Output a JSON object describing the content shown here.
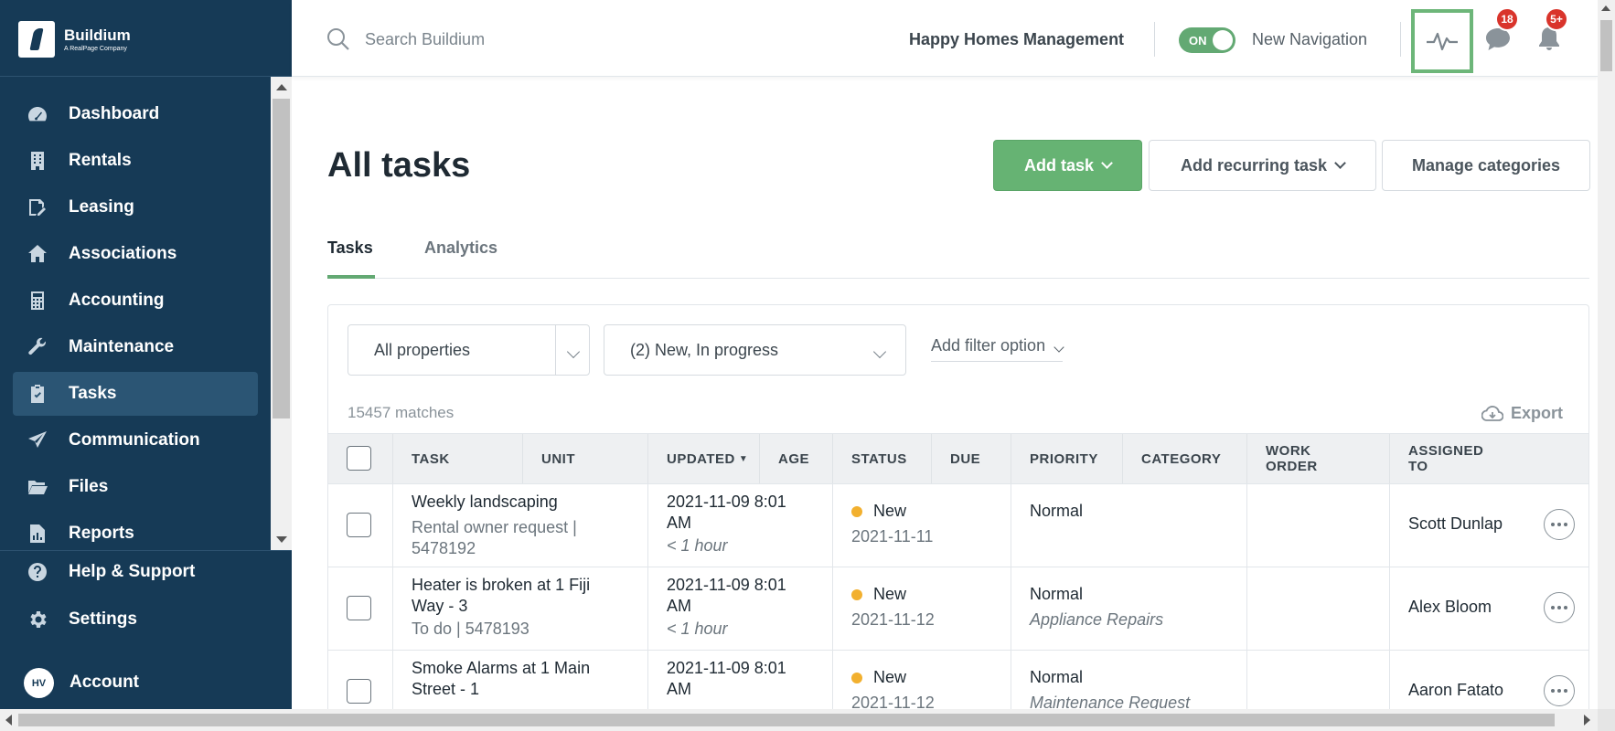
{
  "brand": {
    "name": "Buildium",
    "tagline": "A RealPage Company"
  },
  "sidebar": {
    "items": [
      {
        "label": "Dashboard",
        "icon": "dashboard-icon",
        "active": false
      },
      {
        "label": "Rentals",
        "icon": "building-icon",
        "active": false
      },
      {
        "label": "Leasing",
        "icon": "leasing-icon",
        "active": false
      },
      {
        "label": "Associations",
        "icon": "associations-icon",
        "active": false
      },
      {
        "label": "Accounting",
        "icon": "calculator-icon",
        "active": false
      },
      {
        "label": "Maintenance",
        "icon": "wrench-icon",
        "active": false
      },
      {
        "label": "Tasks",
        "icon": "clipboard-icon",
        "active": true
      },
      {
        "label": "Communication",
        "icon": "paper-plane-icon",
        "active": false
      },
      {
        "label": "Files",
        "icon": "folder-icon",
        "active": false
      },
      {
        "label": "Reports",
        "icon": "reports-icon",
        "active": false
      }
    ],
    "bottom": [
      {
        "label": "Help & Support",
        "icon": "help-icon"
      },
      {
        "label": "Settings",
        "icon": "gear-icon"
      },
      {
        "label": "Account",
        "icon": "avatar"
      }
    ],
    "avatar_initials": "HV"
  },
  "header": {
    "search_placeholder": "Search Buildium",
    "company": "Happy Homes Management",
    "toggle_label": "ON",
    "new_nav_label": "New Navigation",
    "messages_badge": "18",
    "notifications_badge": "5+",
    "accent_color": "#6db679"
  },
  "page": {
    "title": "All tasks",
    "add_task": "Add task",
    "add_recurring": "Add recurring task",
    "manage_categories": "Manage categories",
    "tabs": [
      {
        "label": "Tasks",
        "active": true
      },
      {
        "label": "Analytics",
        "active": false
      }
    ]
  },
  "filters": {
    "property": "All properties",
    "status": "(2) New, In progress",
    "add_filter": "Add filter option",
    "matches": "15457 matches",
    "export": "Export"
  },
  "table": {
    "headers": {
      "task": "TASK",
      "unit": "UNIT",
      "updated": "UPDATED",
      "age": "AGE",
      "status": "STATUS",
      "due": "DUE",
      "priority": "PRIORITY",
      "category": "CATEGORY",
      "work_order_1": "WORK",
      "work_order_2": "ORDER",
      "assigned_1": "ASSIGNED",
      "assigned_2": "TO"
    },
    "rows": [
      {
        "task_1": "Weekly landscaping",
        "task_2": "",
        "sub_1": "Rental owner request |",
        "sub_2": "5478192",
        "updated_1": "2021-11-09 8:01",
        "updated_2": "AM",
        "age": "< 1 hour",
        "status": "New",
        "due": "2021-11-11",
        "priority": "Normal",
        "category": "",
        "assigned": "Scott Dunlap"
      },
      {
        "task_1": "Heater is broken at 1 Fiji",
        "task_2": "Way - 3",
        "sub_1": "To do | 5478193",
        "sub_2": "",
        "updated_1": "2021-11-09 8:01",
        "updated_2": "AM",
        "age": "< 1 hour",
        "status": "New",
        "due": "2021-11-12",
        "priority": "Normal",
        "category": "Appliance Repairs",
        "assigned": "Alex Bloom"
      },
      {
        "task_1": "Smoke Alarms at 1 Main",
        "task_2": "Street - 1",
        "sub_1": "",
        "sub_2": "",
        "updated_1": "2021-11-09 8:01",
        "updated_2": "AM",
        "age": "",
        "status": "New",
        "due": "2021-11-12",
        "priority": "Normal",
        "category": "Maintenance Request",
        "assigned": "Aaron Fatato"
      }
    ]
  }
}
